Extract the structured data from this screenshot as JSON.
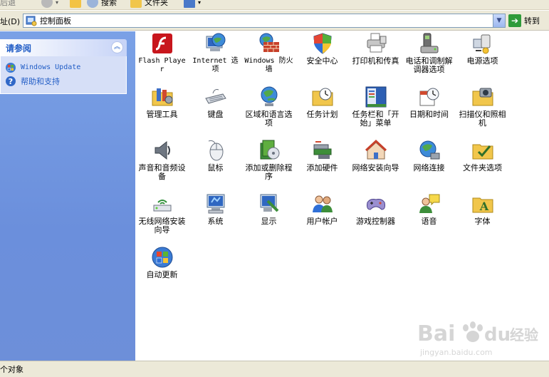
{
  "toolbar": {
    "back_label": "后退",
    "search_label": "搜索",
    "folders_label": "文件夹"
  },
  "address": {
    "label": "址(D)",
    "value": "控制面板",
    "go_label": "转到"
  },
  "sidebar": {
    "panel_title": "请参阅",
    "links": [
      {
        "label": "Windows Update"
      },
      {
        "label": "帮助和支持"
      }
    ]
  },
  "items": [
    {
      "label": "Flash Player"
    },
    {
      "label": "Internet 选项"
    },
    {
      "label": "Windows 防火墙"
    },
    {
      "label": "安全中心"
    },
    {
      "label": "打印机和传真"
    },
    {
      "label": "电话和调制解调器选项"
    },
    {
      "label": "电源选项"
    },
    {
      "label": "管理工具"
    },
    {
      "label": "键盘"
    },
    {
      "label": "区域和语言选项"
    },
    {
      "label": "任务计划"
    },
    {
      "label": "任务栏和「开始」菜单"
    },
    {
      "label": "日期和时间"
    },
    {
      "label": "扫描仪和照相机"
    },
    {
      "label": "声音和音频设备"
    },
    {
      "label": "鼠标"
    },
    {
      "label": "添加或删除程序"
    },
    {
      "label": "添加硬件"
    },
    {
      "label": "网络安装向导"
    },
    {
      "label": "网络连接"
    },
    {
      "label": "文件夹选项"
    },
    {
      "label": "无线网络安装向导"
    },
    {
      "label": "系统"
    },
    {
      "label": "显示"
    },
    {
      "label": "用户帐户"
    },
    {
      "label": "游戏控制器"
    },
    {
      "label": "语音"
    },
    {
      "label": "字体"
    },
    {
      "label": "自动更新"
    }
  ],
  "status": {
    "text": "个对象"
  },
  "watermark": {
    "brand": "Bai",
    "brand2": "du",
    "jingyan": "经验",
    "url": "jingyan.baidu.com"
  }
}
